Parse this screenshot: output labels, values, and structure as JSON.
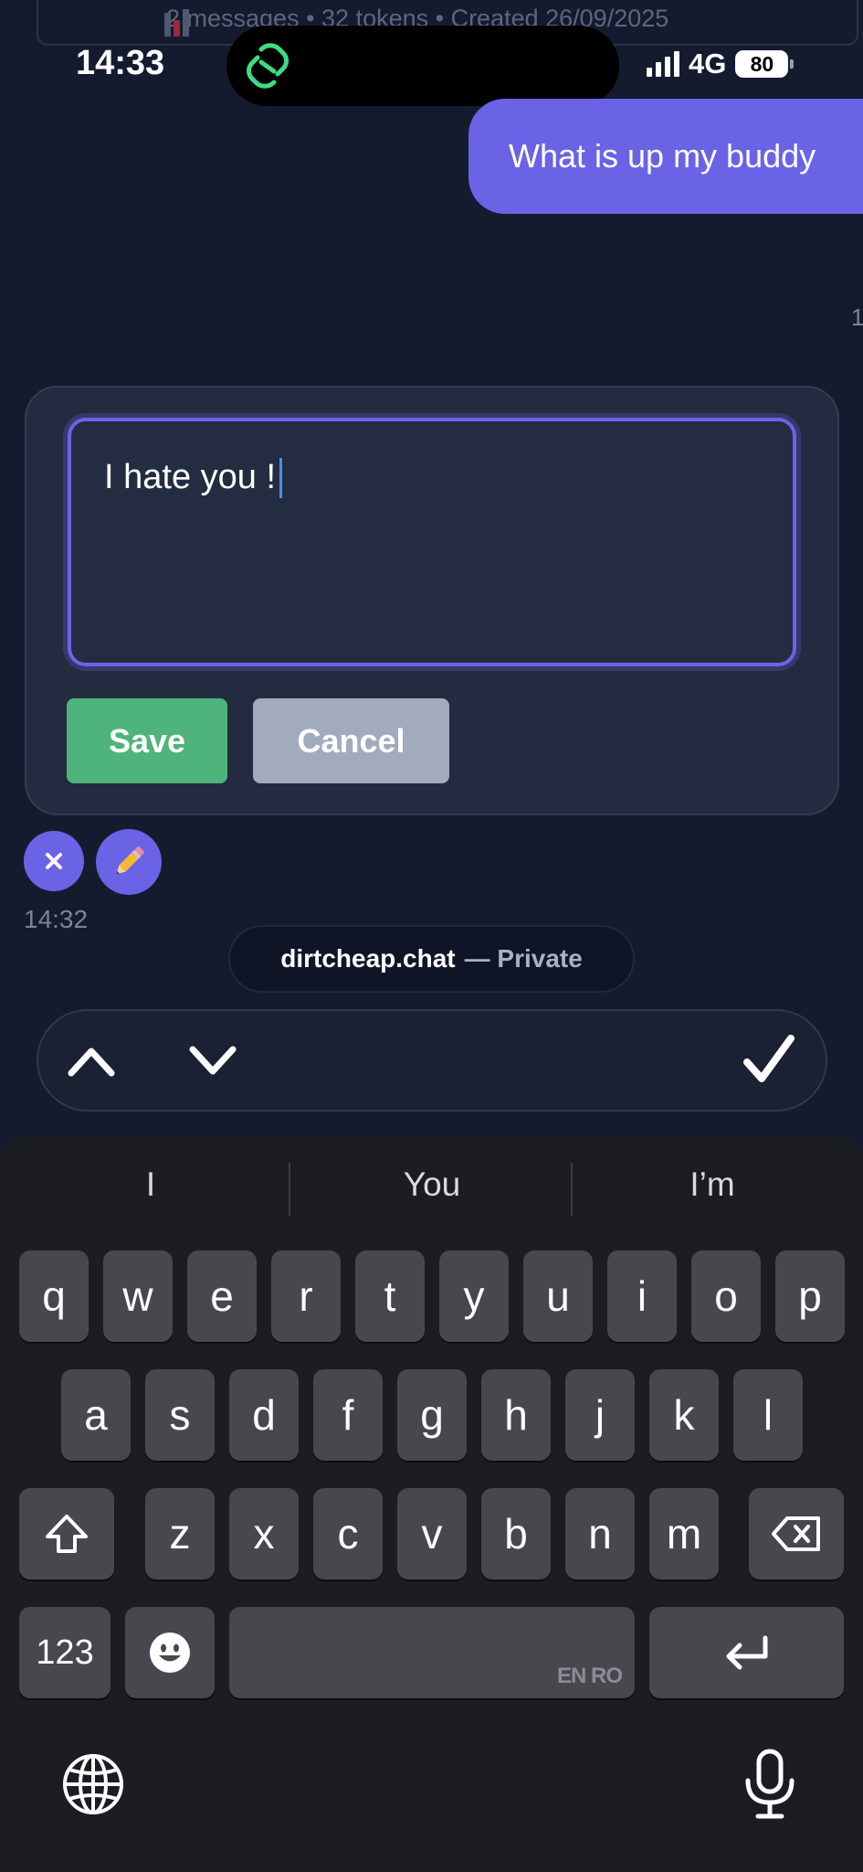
{
  "header": {
    "chat_info": "2 messages • 32 tokens • Created 26/09/2025"
  },
  "status_bar": {
    "time": "14:33",
    "network": "4G",
    "battery": "80"
  },
  "chat": {
    "user_message": "What is up my buddy",
    "side_number": "1",
    "edit": {
      "text": "I hate you !",
      "save_label": "Save",
      "cancel_label": "Cancel"
    },
    "message_time": "14:32"
  },
  "brand": {
    "name": "dirtcheap.chat",
    "suffix": "— Private"
  },
  "keyboard": {
    "suggestions": [
      "I",
      "You",
      "I’m"
    ],
    "row1": [
      "q",
      "w",
      "e",
      "r",
      "t",
      "y",
      "u",
      "i",
      "o",
      "p"
    ],
    "row2": [
      "a",
      "s",
      "d",
      "f",
      "g",
      "h",
      "j",
      "k",
      "l"
    ],
    "row3": [
      "z",
      "x",
      "c",
      "v",
      "b",
      "n",
      "m"
    ],
    "numbers_label": "123",
    "space_languages": "EN RO"
  },
  "colors": {
    "accent": "#6a63e6",
    "save": "#4fb37c",
    "cancel": "#a2abbd",
    "background": "#141b2e"
  }
}
